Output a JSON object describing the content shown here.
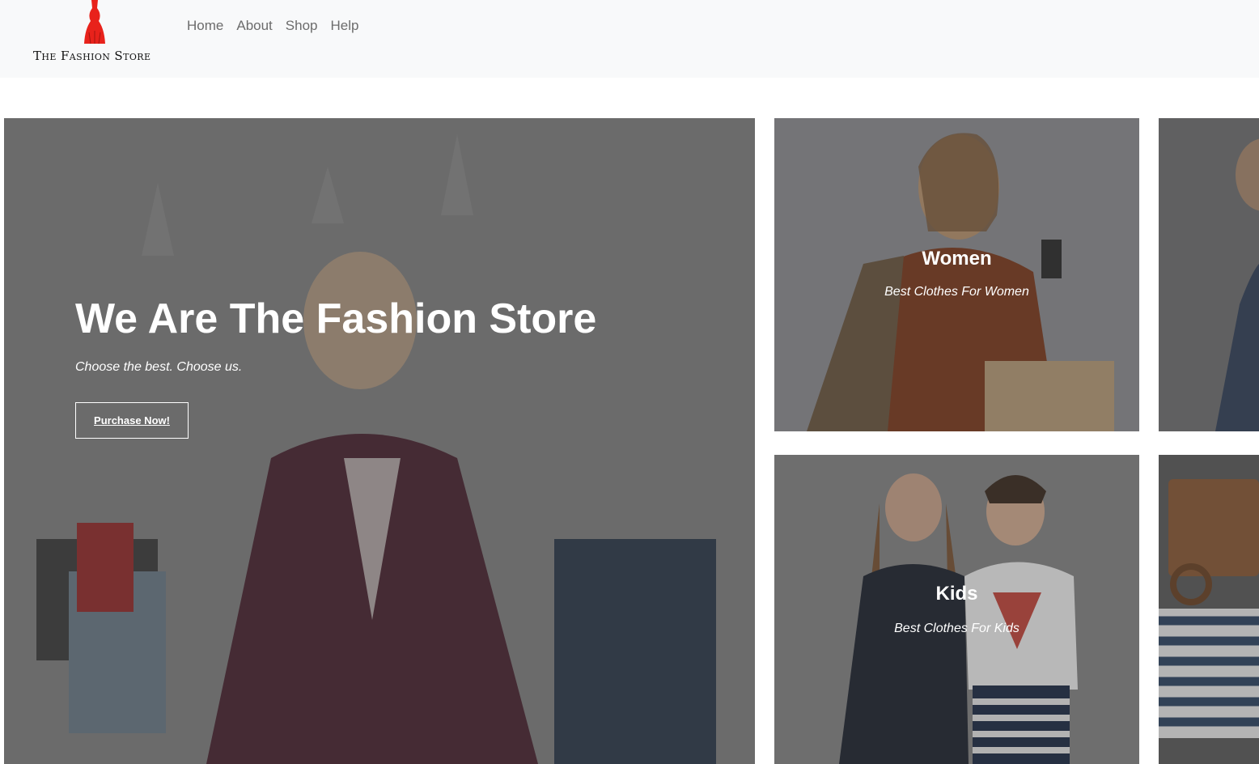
{
  "brand": {
    "name": "The Fashion Store",
    "accent": "#e8221b"
  },
  "nav": {
    "items": [
      "Home",
      "About",
      "Shop",
      "Help"
    ]
  },
  "hero": {
    "title": "We Are The Fashion Store",
    "subtitle": "Choose the best. Choose us.",
    "button_label": "Purchase Now!"
  },
  "categories": [
    {
      "title": "Women",
      "subtitle": "Best Clothes For Women"
    },
    {
      "title": "Kids",
      "subtitle": "Best Clothes For Kids"
    }
  ],
  "colors": {
    "navbar_bg": "#f8f9fa",
    "nav_text": "#6c6c6c",
    "overlay_text": "#ffffff"
  }
}
